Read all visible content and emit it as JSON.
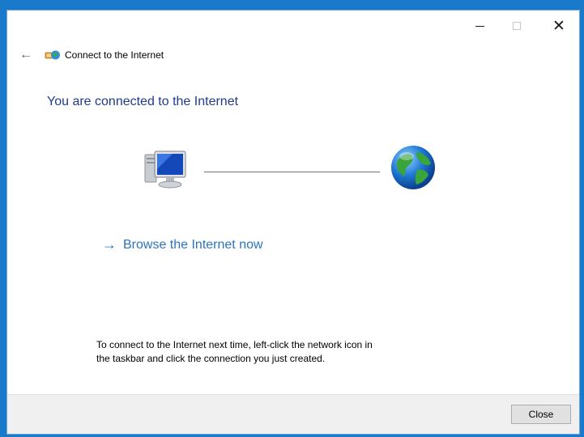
{
  "window": {
    "title": "Connect to the Internet",
    "controls": {
      "minimize_icon": "minimize-icon",
      "maximize_icon": "maximize-icon",
      "close_glyph": "✕"
    }
  },
  "nav": {
    "back_glyph": "←",
    "icon": "network-wizard-icon"
  },
  "content": {
    "heading": "You are connected to the Internet",
    "diagram": {
      "left_icon": "computer-icon",
      "right_icon": "globe-icon"
    },
    "browse_link": {
      "arrow": "→",
      "label": "Browse the Internet now"
    },
    "info_line1": "To connect to the Internet next time, left-click the network icon in",
    "info_line2": "the taskbar and click the connection you just created."
  },
  "footer": {
    "close_label": "Close"
  },
  "colors": {
    "desktop": "#1979ca",
    "heading": "#1e3b8c",
    "link": "#2b74bf",
    "footer_bg": "#f0f0f0"
  }
}
